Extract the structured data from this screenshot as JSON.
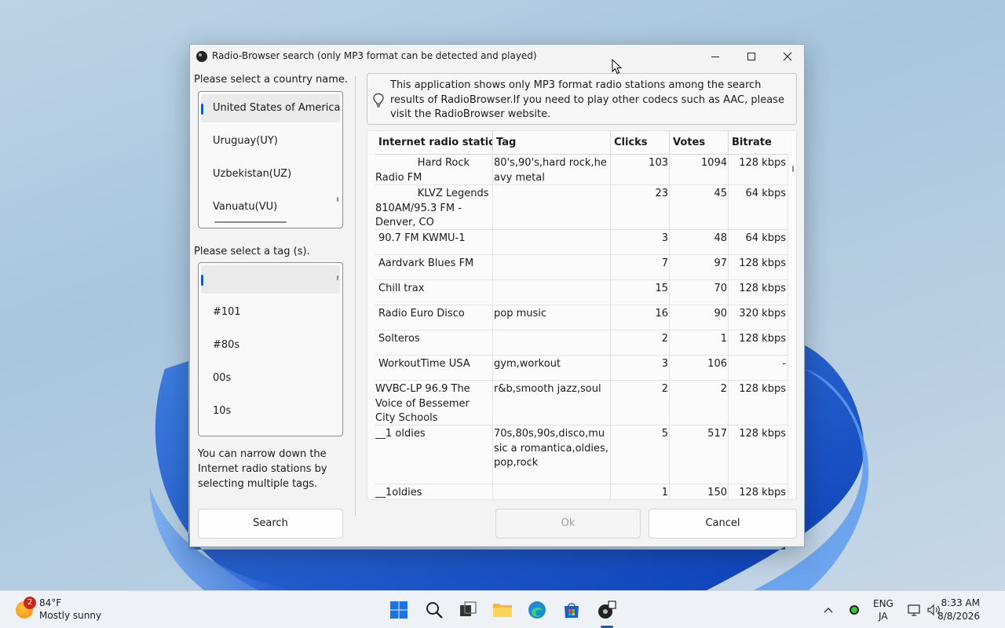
{
  "window": {
    "title": "Radio-Browser search (only MP3 format can be detected and played)"
  },
  "left": {
    "country_label": "Please select a country name.",
    "countries": [
      "United States of America(US)",
      "Uruguay(UY)",
      "Uzbekistan(UZ)",
      "Vanuatu(VU)"
    ],
    "tag_label": "Please select a tag (s).",
    "tags": [
      "",
      "#101",
      "#80s",
      "00s",
      "10s"
    ],
    "hint": "You can narrow down the Internet radio stations by selecting multiple tags.",
    "search_label": "Search"
  },
  "info": {
    "text": "This application shows only MP3 format radio stations among the search results of RadioBrowser.If you need to play other codecs such as AAC, please visit the RadioBrowser website."
  },
  "grid": {
    "columns": [
      "Internet radio station",
      "Tag",
      "Clicks",
      "Votes",
      "Bitrate"
    ],
    "rows": [
      {
        "name": "             Hard Rock Radio FM",
        "tag": "80's,90's,hard rock,heavy metal",
        "clicks": "103",
        "votes": "1094",
        "bitrate": "128 kbps"
      },
      {
        "name": "             KLVZ Legends 810AM/95.3 FM - Denver, CO",
        "tag": "",
        "clicks": "23",
        "votes": "45",
        "bitrate": "64 kbps"
      },
      {
        "name": "90.7 FM KWMU-1",
        "tag": "",
        "clicks": "3",
        "votes": "48",
        "bitrate": "64 kbps"
      },
      {
        "name": "Aardvark Blues FM",
        "tag": "",
        "clicks": "7",
        "votes": "97",
        "bitrate": "128 kbps"
      },
      {
        "name": "Chill trax",
        "tag": "",
        "clicks": "15",
        "votes": "70",
        "bitrate": "128 kbps"
      },
      {
        "name": "Radio Euro Disco",
        "tag": "pop music",
        "clicks": "16",
        "votes": "90",
        "bitrate": "320 kbps"
      },
      {
        "name": "Solteros",
        "tag": "",
        "clicks": "2",
        "votes": "1",
        "bitrate": "128 kbps"
      },
      {
        "name": "WorkoutTime USA",
        "tag": "gym,workout",
        "clicks": "3",
        "votes": "106",
        "bitrate": "-"
      },
      {
        "name": "WVBC-LP 96.9 The Voice of Bessemer City Schools",
        "tag": "r&b,smooth jazz,soul",
        "clicks": "2",
        "votes": "2",
        "bitrate": "128 kbps"
      },
      {
        "name": "__1 oldies",
        "tag": "70s,80s,90s,disco,music a romantica,oldies,pop,rock",
        "clicks": "5",
        "votes": "517",
        "bitrate": "128 kbps"
      },
      {
        "name": "__1oldies",
        "tag": "",
        "clicks": "1",
        "votes": "150",
        "bitrate": "128 kbps"
      }
    ]
  },
  "buttons": {
    "ok_label": "Ok",
    "cancel_label": "Cancel"
  },
  "taskbar": {
    "weather_badge": "2",
    "weather_temp": "84°F",
    "weather_desc": "Mostly sunny",
    "lang_top": "ENG",
    "lang_bottom": "JA",
    "time": "8:33 AM",
    "date": "8/8/2026"
  }
}
